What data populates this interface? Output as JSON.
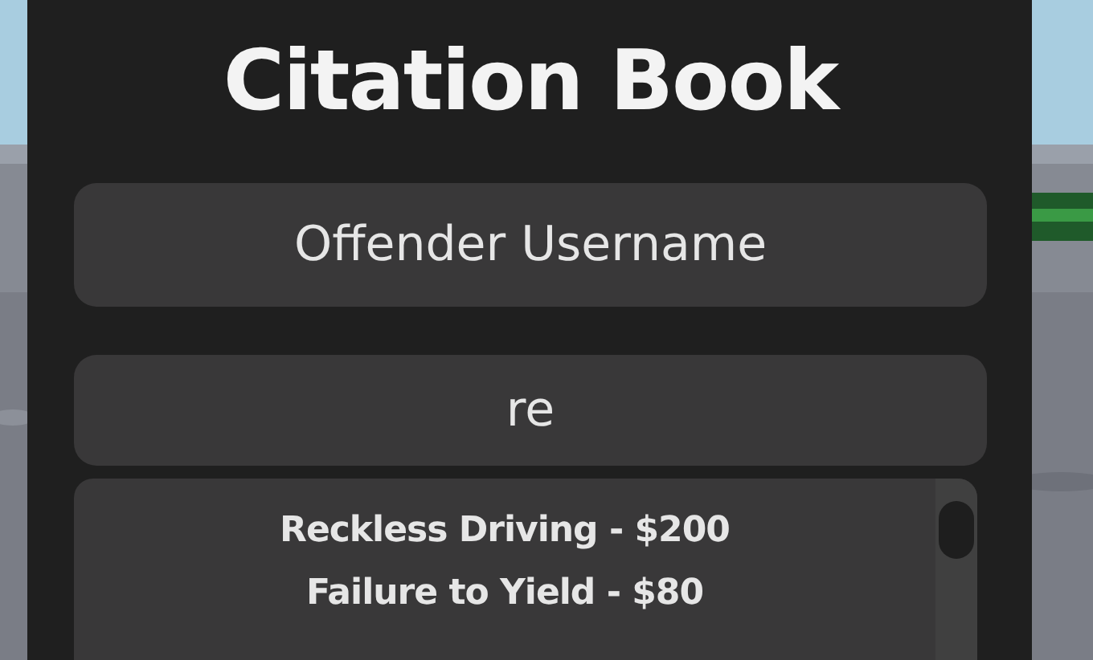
{
  "title": "Citation Book",
  "username_field": {
    "placeholder": "Offender Username"
  },
  "search_field": {
    "value": "re"
  },
  "citations": [
    {
      "label": "Reckless Driving - $200"
    },
    {
      "label": "Failure to Yield - $80"
    }
  ]
}
